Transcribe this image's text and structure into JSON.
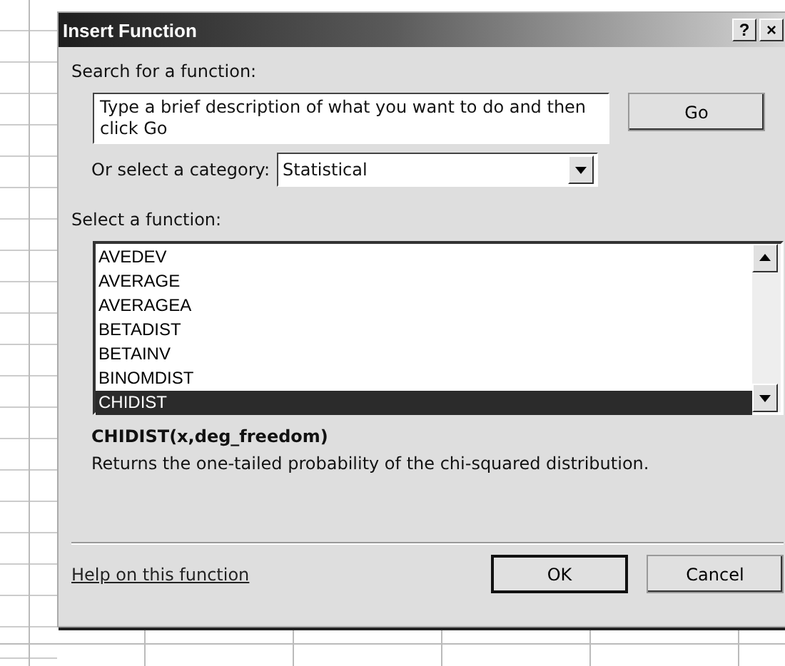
{
  "window": {
    "title": "Insert Function",
    "title_buttons": [
      "?",
      "×"
    ]
  },
  "search": {
    "label": "Search for a function:",
    "value": "Type a brief description of what you want to do and then click Go",
    "button": "Go"
  },
  "category": {
    "label": "Or select a category:",
    "value": "Statistical"
  },
  "functions": {
    "label": "Select a function:",
    "items": [
      {
        "name": "AVEDEV",
        "selected": false
      },
      {
        "name": "AVERAGE",
        "selected": false
      },
      {
        "name": "AVERAGEA",
        "selected": false
      },
      {
        "name": "BETADIST",
        "selected": false
      },
      {
        "name": "BETAINV",
        "selected": false
      },
      {
        "name": "BINOMDIST",
        "selected": false
      },
      {
        "name": "CHIDIST",
        "selected": true
      }
    ]
  },
  "signature": "CHIDIST(x,deg_freedom)",
  "description": "Returns the one-tailed probability of the chi-squared distribution.",
  "help_link": "Help on this function",
  "buttons": [
    {
      "label": "OK",
      "default": true
    },
    {
      "label": "Cancel",
      "default": false
    }
  ]
}
